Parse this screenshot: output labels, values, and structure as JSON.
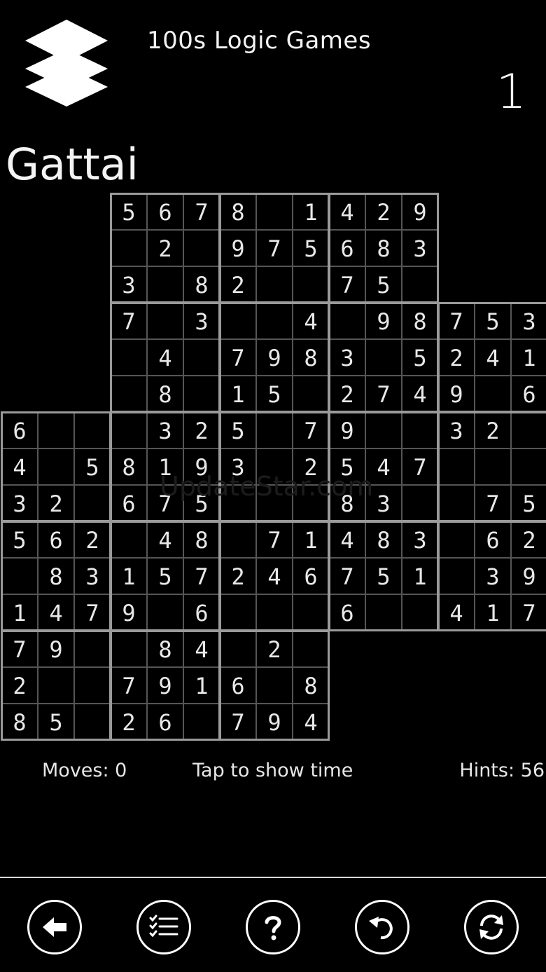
{
  "header": {
    "app_title": "100s Logic Games",
    "puzzle_number": "1",
    "logo_icon": "stacked-layers-icon"
  },
  "page_title": "Gattai",
  "watermark": "UpdateStar.com",
  "puzzle": {
    "boxes": [
      {
        "r": 0,
        "c": 1,
        "digits": [
          "5",
          "6",
          "7",
          "",
          "2",
          "",
          "3",
          "",
          "8"
        ]
      },
      {
        "r": 0,
        "c": 2,
        "digits": [
          "8",
          "",
          "1",
          "9",
          "7",
          "5",
          "2",
          "",
          ""
        ]
      },
      {
        "r": 0,
        "c": 3,
        "digits": [
          "4",
          "2",
          "9",
          "6",
          "8",
          "3",
          "7",
          "5",
          ""
        ]
      },
      {
        "r": 1,
        "c": 1,
        "digits": [
          "7",
          "",
          "3",
          "",
          "4",
          "",
          "",
          "8",
          ""
        ]
      },
      {
        "r": 1,
        "c": 2,
        "digits": [
          "",
          "",
          "4",
          "7",
          "9",
          "8",
          "1",
          "5",
          ""
        ]
      },
      {
        "r": 1,
        "c": 3,
        "digits": [
          "",
          "9",
          "8",
          "3",
          "",
          "5",
          "2",
          "7",
          "4"
        ]
      },
      {
        "r": 1,
        "c": 4,
        "digits": [
          "7",
          "5",
          "3",
          "2",
          "4",
          "1",
          "9",
          "",
          "6"
        ]
      },
      {
        "r": 2,
        "c": 0,
        "digits": [
          "6",
          "",
          "",
          "4",
          "",
          "5",
          "3",
          "2",
          ""
        ]
      },
      {
        "r": 2,
        "c": 1,
        "digits": [
          "",
          "3",
          "2",
          "8",
          "1",
          "9",
          "6",
          "7",
          "5"
        ]
      },
      {
        "r": 2,
        "c": 2,
        "digits": [
          "5",
          "",
          "7",
          "3",
          "",
          "2",
          "",
          "",
          ""
        ]
      },
      {
        "r": 2,
        "c": 3,
        "digits": [
          "9",
          "",
          "",
          "5",
          "4",
          "7",
          "8",
          "3",
          ""
        ]
      },
      {
        "r": 2,
        "c": 4,
        "digits": [
          "3",
          "2",
          "",
          "",
          "",
          "",
          "",
          "7",
          "5"
        ]
      },
      {
        "r": 3,
        "c": 0,
        "digits": [
          "5",
          "6",
          "2",
          "",
          "8",
          "3",
          "1",
          "4",
          "7"
        ]
      },
      {
        "r": 3,
        "c": 1,
        "digits": [
          "",
          "4",
          "8",
          "1",
          "5",
          "7",
          "9",
          "",
          "6"
        ]
      },
      {
        "r": 3,
        "c": 2,
        "digits": [
          "",
          "7",
          "1",
          "2",
          "4",
          "6",
          "",
          "",
          ""
        ]
      },
      {
        "r": 3,
        "c": 3,
        "digits": [
          "4",
          "8",
          "3",
          "7",
          "5",
          "1",
          "6",
          "",
          ""
        ]
      },
      {
        "r": 3,
        "c": 4,
        "digits": [
          "",
          "6",
          "2",
          "",
          "3",
          "9",
          "4",
          "1",
          "7"
        ]
      },
      {
        "r": 4,
        "c": 0,
        "digits": [
          "7",
          "9",
          "",
          "2",
          "",
          "",
          "8",
          "5",
          ""
        ]
      },
      {
        "r": 4,
        "c": 1,
        "digits": [
          "",
          "8",
          "4",
          "7",
          "9",
          "1",
          "2",
          "6",
          ""
        ]
      },
      {
        "r": 4,
        "c": 2,
        "digits": [
          "",
          "2",
          "",
          "6",
          "",
          "8",
          "7",
          "9",
          "4"
        ]
      }
    ]
  },
  "status": {
    "moves": "Moves: 0",
    "timer": "Tap to show time",
    "hints": "Hints: 56"
  },
  "toolbar": [
    {
      "name": "back-button",
      "icon": "arrow-left-icon"
    },
    {
      "name": "menu-button",
      "icon": "checklist-icon"
    },
    {
      "name": "help-button",
      "icon": "question-icon"
    },
    {
      "name": "undo-button",
      "icon": "undo-icon"
    },
    {
      "name": "restart-button",
      "icon": "refresh-icon"
    }
  ]
}
